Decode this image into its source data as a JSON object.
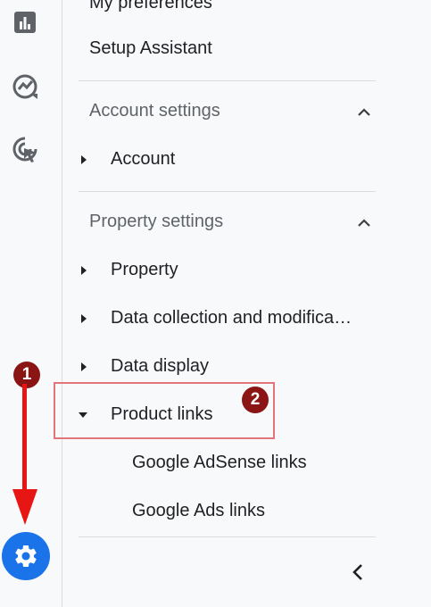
{
  "rail": {
    "icons": [
      "bar-chart-icon",
      "explore-icon",
      "advertising-icon",
      "settings-icon"
    ]
  },
  "menu": {
    "my_preferences": "My preferences",
    "setup_assistant": "Setup Assistant",
    "account_section": {
      "title": "Account settings",
      "items": [
        {
          "label": "Account",
          "expanded": false
        }
      ]
    },
    "property_section": {
      "title": "Property settings",
      "items": [
        {
          "label": "Property",
          "expanded": false
        },
        {
          "label": "Data collection and modifica…",
          "expanded": false
        },
        {
          "label": "Data display",
          "expanded": false
        },
        {
          "label": "Product links",
          "expanded": true,
          "children": [
            "Google AdSense links",
            "Google Ads links"
          ]
        }
      ]
    }
  },
  "annotations": {
    "step1": "1",
    "step2": "2"
  },
  "colors": {
    "accent": "#1a73e8",
    "annotation_red": "#e81515",
    "badge": "#8b1515",
    "highlight_border": "#e2747a"
  }
}
